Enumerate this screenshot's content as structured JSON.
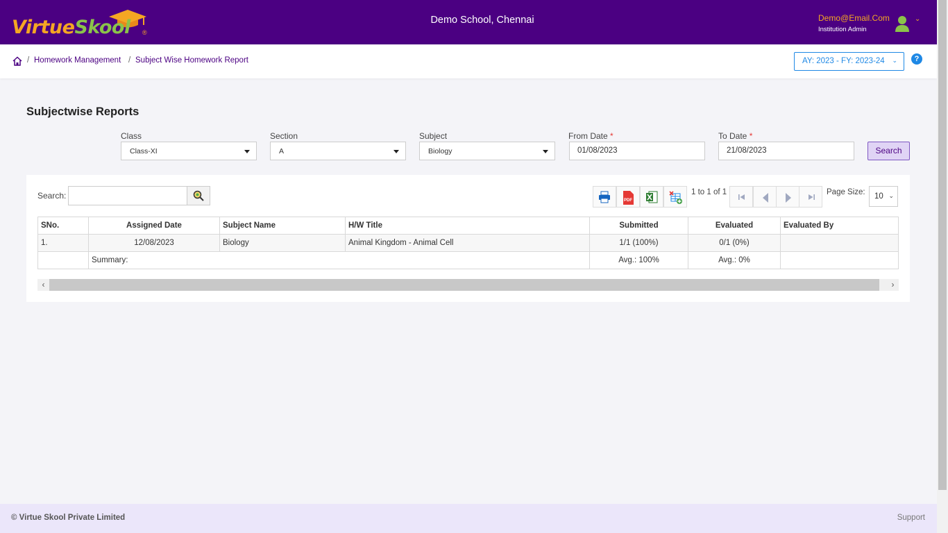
{
  "header": {
    "logo_part1": "Virtue",
    "logo_part2": "Skool",
    "logo_reg": "®",
    "school_name": "Demo School, Chennai",
    "user_email": "Demo@Email.Com",
    "user_role": "Institution Admin",
    "accent": "#4b0082"
  },
  "breadcrumb": {
    "items": [
      "Homework Management",
      "Subject Wise Homework Report"
    ],
    "separator": "/",
    "academic_year": "AY: 2023 - FY: 2023-24",
    "help": "?"
  },
  "page": {
    "title": "Subjectwise Reports"
  },
  "filters": {
    "class_label": "Class",
    "class_value": "Class-XI",
    "section_label": "Section",
    "section_value": "A",
    "subject_label": "Subject",
    "subject_value": "Biology",
    "from_label": "From Date",
    "from_value": "01/08/2023",
    "to_label": "To Date",
    "to_value": "21/08/2023",
    "required_mark": "*",
    "search_button": "Search"
  },
  "grid": {
    "search_label": "Search:",
    "pager_text": "1 to 1 of 1",
    "page_size_label": "Page Size:",
    "page_size": "10",
    "columns": [
      "SNo.",
      "Assigned Date",
      "Subject Name",
      "H/W Title",
      "Submitted",
      "Evaluated",
      "Evaluated By"
    ],
    "rows": [
      [
        "1.",
        "12/08/2023",
        "Biology",
        "Animal Kingdom - Animal Cell",
        "1/1 (100%)",
        "0/1 (0%)",
        ""
      ]
    ],
    "summary": {
      "label": "Summary:",
      "submitted": "Avg.: 100%",
      "evaluated": "Avg.: 0%"
    }
  },
  "footer": {
    "copyright": "© Virtue Skool Private Limited",
    "support": "Support"
  }
}
